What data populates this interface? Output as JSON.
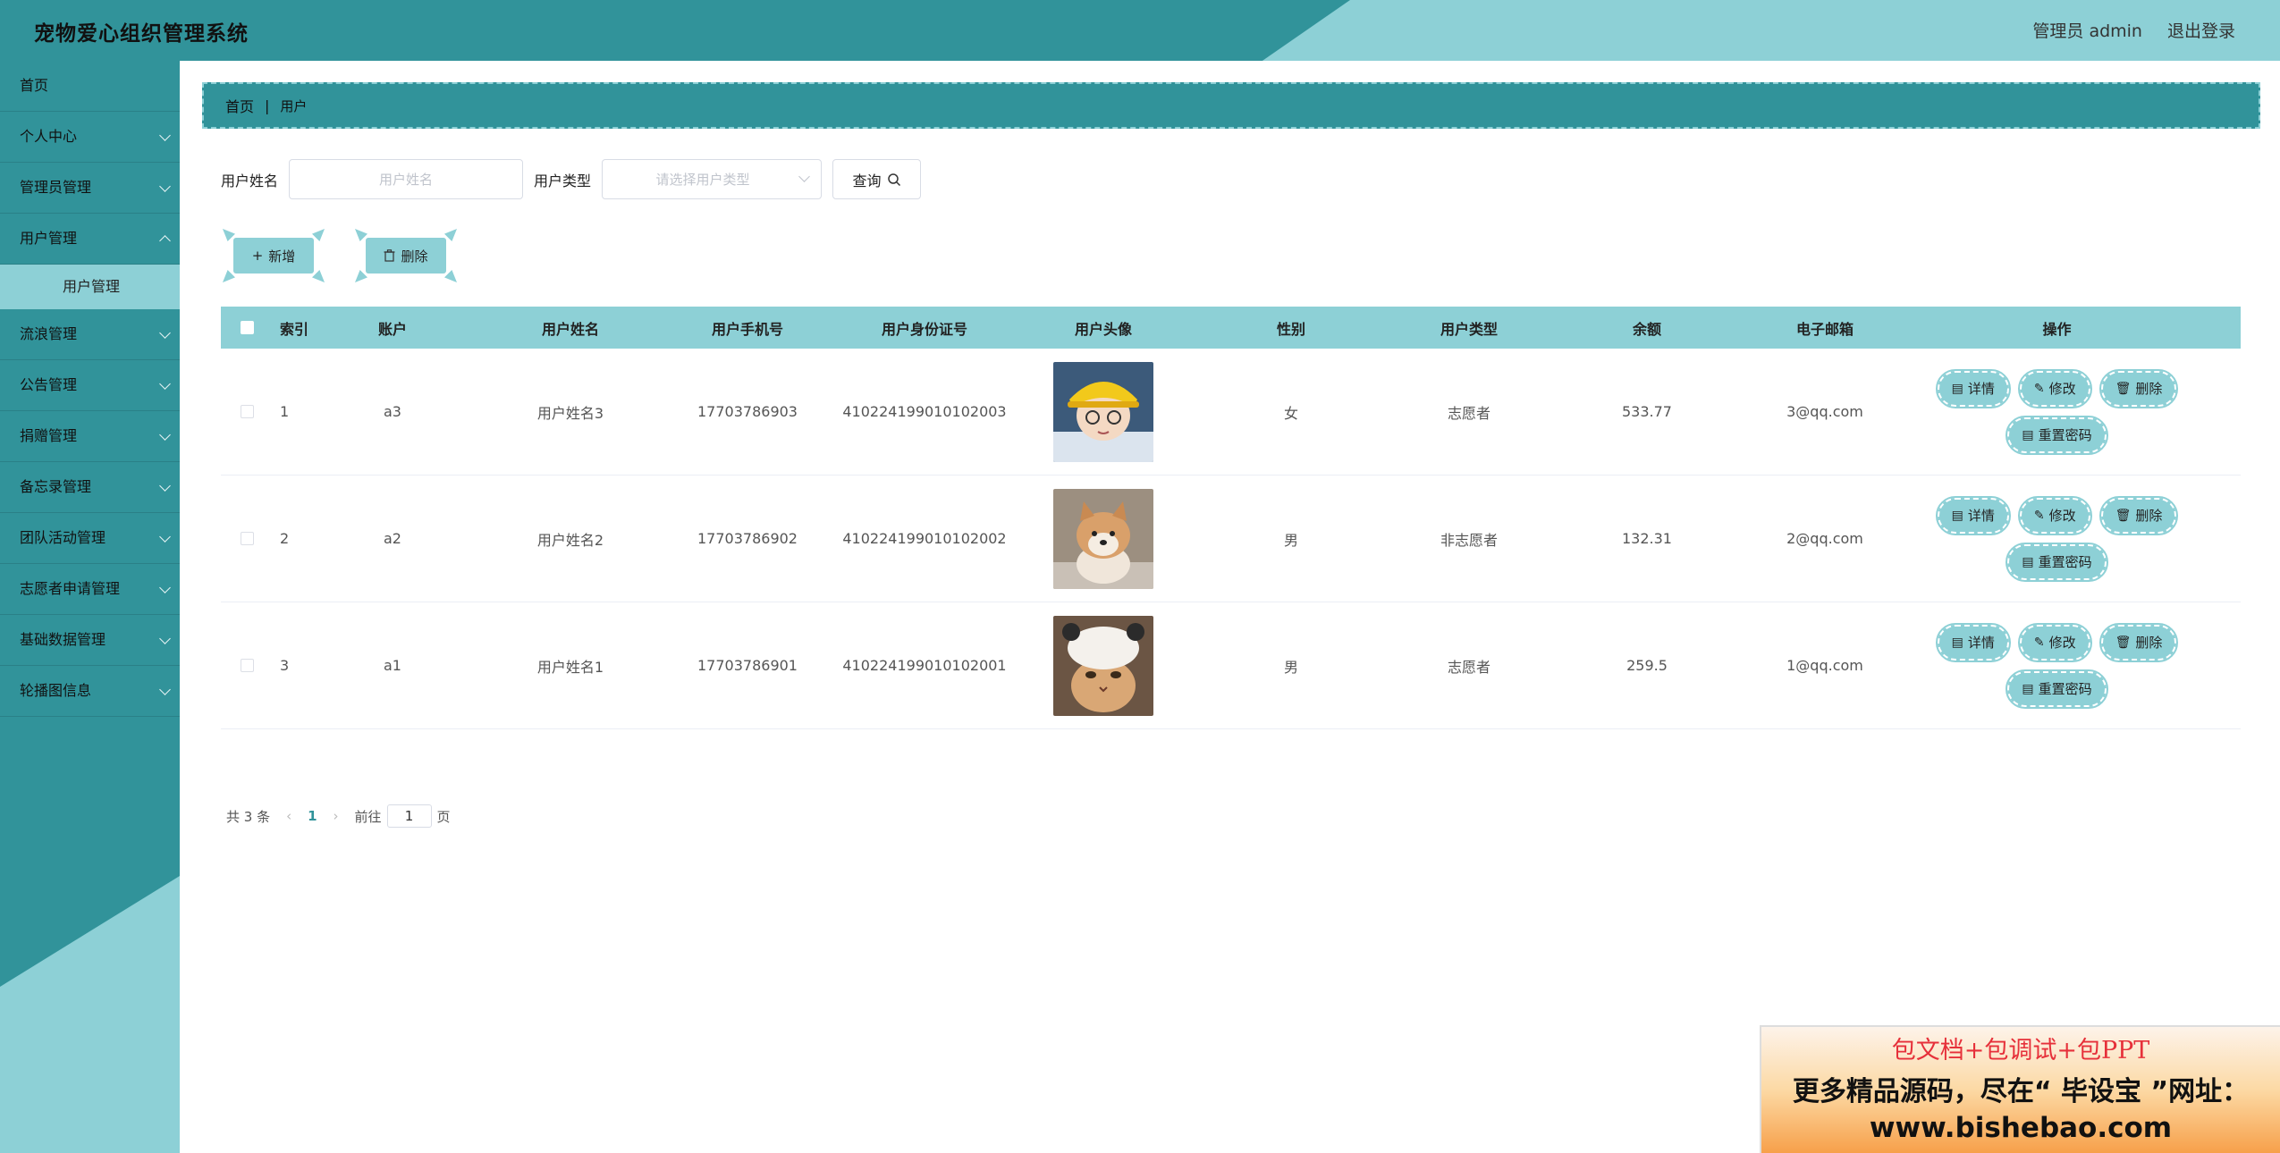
{
  "app": {
    "title": "宠物爱心组织管理系统"
  },
  "header": {
    "admin_label": "管理员 admin",
    "logout_label": "退出登录"
  },
  "sidebar": {
    "items": [
      {
        "label": "首页",
        "expandable": false
      },
      {
        "label": "个人中心",
        "expandable": true
      },
      {
        "label": "管理员管理",
        "expandable": true
      },
      {
        "label": "用户管理",
        "expandable": true,
        "open": true,
        "sub": "用户管理"
      },
      {
        "label": "流浪管理",
        "expandable": true
      },
      {
        "label": "公告管理",
        "expandable": true
      },
      {
        "label": "捐赠管理",
        "expandable": true
      },
      {
        "label": "备忘录管理",
        "expandable": true
      },
      {
        "label": "团队活动管理",
        "expandable": true
      },
      {
        "label": "志愿者申请管理",
        "expandable": true
      },
      {
        "label": "基础数据管理",
        "expandable": true
      },
      {
        "label": "轮播图信息",
        "expandable": true
      }
    ]
  },
  "breadcrumb": {
    "home": "首页",
    "sep": "|",
    "current": "用户"
  },
  "search": {
    "name_label": "用户姓名",
    "name_placeholder": "用户姓名",
    "type_label": "用户类型",
    "type_placeholder": "请选择用户类型",
    "query_label": "查询"
  },
  "actions": {
    "add_label": "新增",
    "delete_label": "删除"
  },
  "table": {
    "columns": [
      "索引",
      "账户",
      "用户姓名",
      "用户手机号",
      "用户身份证号",
      "用户头像",
      "性别",
      "用户类型",
      "余额",
      "电子邮箱",
      "操作"
    ],
    "rows": [
      {
        "index": "1",
        "account": "a3",
        "name": "用户姓名3",
        "phone": "17703786903",
        "id_no": "410224199010102003",
        "avatar": "avatar-cartoon-boy",
        "sex": "女",
        "type": "志愿者",
        "balance": "533.77",
        "email": "3@qq.com"
      },
      {
        "index": "2",
        "account": "a2",
        "name": "用户姓名2",
        "phone": "17703786902",
        "id_no": "410224199010102002",
        "avatar": "avatar-shiba-dog",
        "sex": "男",
        "type": "非志愿者",
        "balance": "132.31",
        "email": "2@qq.com"
      },
      {
        "index": "3",
        "account": "a1",
        "name": "用户姓名1",
        "phone": "17703786901",
        "id_no": "410224199010102001",
        "avatar": "avatar-cat-hat",
        "sex": "男",
        "type": "志愿者",
        "balance": "259.5",
        "email": "1@qq.com"
      }
    ],
    "op_labels": {
      "detail": "详情",
      "edit": "修改",
      "delete": "删除",
      "reset": "重置密码"
    }
  },
  "pager": {
    "total": "共 3 条",
    "current": "1",
    "goto_prefix": "前往",
    "goto_value": "1",
    "goto_suffix": "页"
  },
  "ad": {
    "line1": "包文档+包调试+包PPT",
    "line2": "更多精品源码，尽在“ 毕设宝 ”网址：",
    "line3": "www.bishebao.com"
  },
  "colors": {
    "primary": "#31939a",
    "accent": "#8dd0d6"
  }
}
